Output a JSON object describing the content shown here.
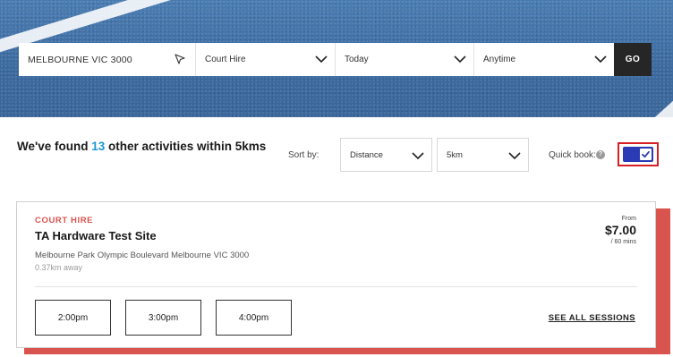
{
  "search": {
    "location": "MELBOURNE  VIC 3000",
    "activity": "Court Hire",
    "date": "Today",
    "time": "Anytime",
    "go_label": "GO"
  },
  "results": {
    "prefix": "We've found ",
    "count": "13",
    "suffix": " other activities within 5kms"
  },
  "sort": {
    "label": "Sort by:",
    "sort_value": "Distance",
    "radius_value": "5km"
  },
  "quick_book": {
    "label": "Quick book:",
    "help_glyph": "?",
    "checked": true
  },
  "card": {
    "category": "COURT HIRE",
    "name": "TA Hardware Test Site",
    "address": "Melbourne Park Olympic Boulevard Melbourne VIC 3000",
    "distance": "0.37km away",
    "from_label": "From",
    "price": "$7.00",
    "per_label": "/ 60 mins",
    "sessions": [
      "2:00pm",
      "3:00pm",
      "4:00pm"
    ],
    "see_all_label": "SEE ALL SESSIONS"
  },
  "colors": {
    "accent_red": "#d9534f",
    "count_blue": "#1a97d5",
    "toggle_blue": "#2b3bb5"
  }
}
